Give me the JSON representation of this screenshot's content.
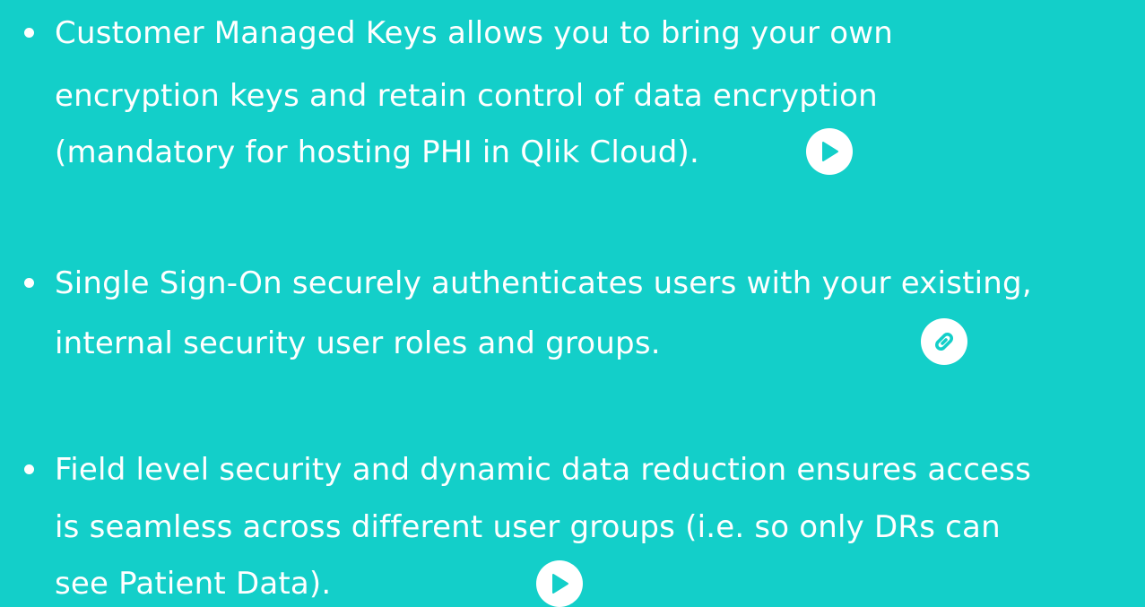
{
  "items": [
    {
      "lines": [
        " Customer Managed Keys allows you to bring your own",
        "encryption keys and retain control of data encryption",
        "(mandatory for hosting PHI in Qlik Cloud)."
      ],
      "icon": "play-icon"
    },
    {
      "lines": [
        " Single Sign-On securely authenticates users with your existing,",
        "internal security user roles and groups."
      ],
      "icon": "link-icon"
    },
    {
      "lines": [
        " Field level security and dynamic data reduction ensures access",
        "is seamless across different user groups (i.e. so only DRs can",
        "see Patient Data)."
      ],
      "icon": "play-icon"
    }
  ],
  "colors": {
    "background": "#13cfc9",
    "text": "#ffffff",
    "icon_glyph": "#13cfc9"
  }
}
